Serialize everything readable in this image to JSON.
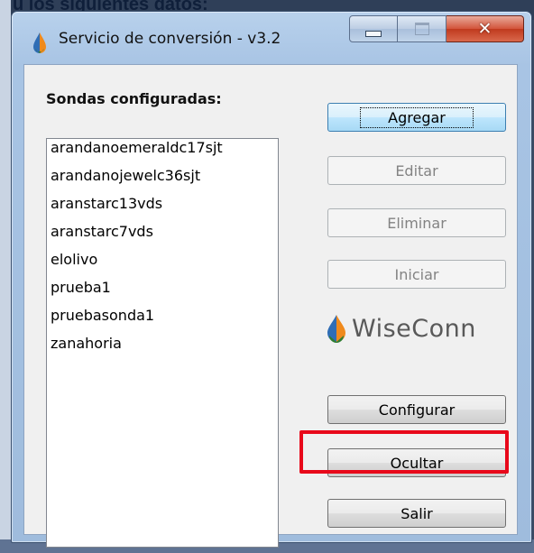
{
  "window": {
    "title": "Servicio de conversión - v3.2",
    "accent": "#e8081a"
  },
  "background_text": "u los siguientes datos:",
  "list": {
    "label": "Sondas configuradas:",
    "items": [
      "arandanoemeraldc17sjt",
      "arandanojewelc36sjt",
      "aranstarc13vds",
      "aranstarc7vds",
      "elolivo",
      "prueba1",
      "pruebasonda1",
      "zanahoria"
    ]
  },
  "buttons": {
    "agregar": "Agregar",
    "editar": "Editar",
    "eliminar": "Eliminar",
    "iniciar": "Iniciar",
    "configurar": "Configurar",
    "ocultar": "Ocultar",
    "salir": "Salir"
  },
  "logo": {
    "text": "WiseConn",
    "icon": "water-drop-icon",
    "colors": [
      "#2f6db5",
      "#f08a1c",
      "#2e7d32"
    ]
  },
  "caption_icons": [
    "minimize-icon",
    "maximize-icon",
    "close-icon"
  ]
}
